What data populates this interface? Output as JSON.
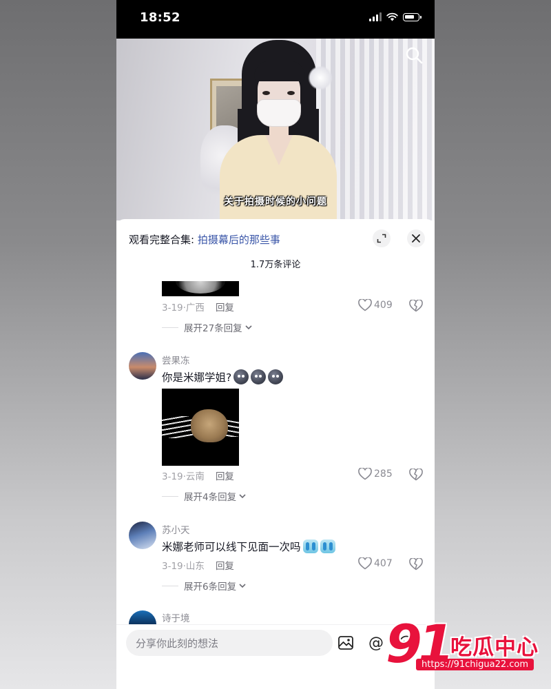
{
  "status_bar": {
    "time": "18:52",
    "battery_level": 0.75
  },
  "video": {
    "subtitle": "关于拍摄时候的小问题"
  },
  "sheet": {
    "collection_prefix": "观看完整合集: ",
    "collection_link": "拍摄幕后的那些事",
    "comment_count": "1.7万条评论"
  },
  "comments": [
    {
      "username": "",
      "text": "",
      "date": "3-19·广西",
      "reply": "回复",
      "likes": "409",
      "expand": "展开27条回复"
    },
    {
      "username": "尝果冻",
      "text": "你是米娜学姐?",
      "date": "3-19·云南",
      "reply": "回复",
      "likes": "285",
      "expand": "展开4条回复"
    },
    {
      "username": "苏小天",
      "text": "米娜老师可以线下见面一次吗",
      "date": "3-19·山东",
      "reply": "回复",
      "likes": "407",
      "expand": "展开6条回复"
    },
    {
      "username": "诗于境"
    }
  ],
  "input": {
    "placeholder": "分享你此刻的想法",
    "at_symbol": "@"
  },
  "watermark": {
    "number": "91",
    "brand": "吃瓜中心",
    "url": "https://91chigua22.com"
  },
  "colors": {
    "link": "#3a56a8",
    "watermark": "#e8123c",
    "text": "#161823",
    "secondary": "#8a8a92"
  }
}
